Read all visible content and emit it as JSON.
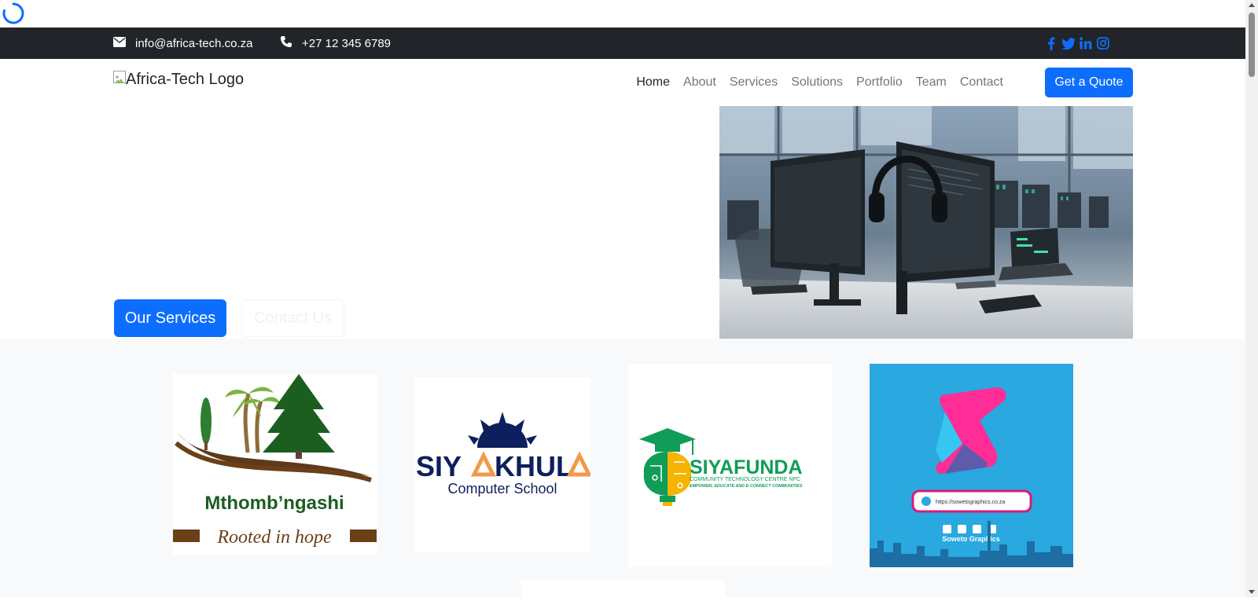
{
  "topbar": {
    "email": "info@africa-tech.co.za",
    "phone": "+27 12 345 6789",
    "socials": [
      "facebook-icon",
      "twitter-icon",
      "linkedin-icon",
      "instagram-icon"
    ]
  },
  "navbar": {
    "logo_alt": "Africa-Tech Logo",
    "items": [
      {
        "label": "Home",
        "active": true
      },
      {
        "label": "About"
      },
      {
        "label": "Services"
      },
      {
        "label": "Solutions"
      },
      {
        "label": "Portfolio"
      },
      {
        "label": "Team"
      },
      {
        "label": "Contact"
      }
    ],
    "cta": "Get a Quote"
  },
  "hero": {
    "primary_button": "Our Services",
    "secondary_button": "Contact Us"
  },
  "partners": {
    "mthombngashi": {
      "name": "Mthomb’ngashi",
      "tagline": "Rooted in hope"
    },
    "siyakhula": {
      "name_part1": "SIY",
      "name_part2": "KHUL",
      "subtitle": "Computer School"
    },
    "siyafunda": {
      "name": "SIYAFUNDA",
      "line1": "COMMUNITY TECHNOLOGY CENTRE NPC",
      "line2": "EMPOWER, EDUCATE AND E-CONNECT COMMUNITIES"
    },
    "soweto": {
      "url": "https://sowetographics.co.za",
      "name": "Soweto Graphics"
    }
  },
  "colors": {
    "primary": "#0d6efd",
    "topbar_bg": "#212529",
    "section_bg": "#f8f9fa",
    "soweto_blue": "#2aa8e0"
  }
}
